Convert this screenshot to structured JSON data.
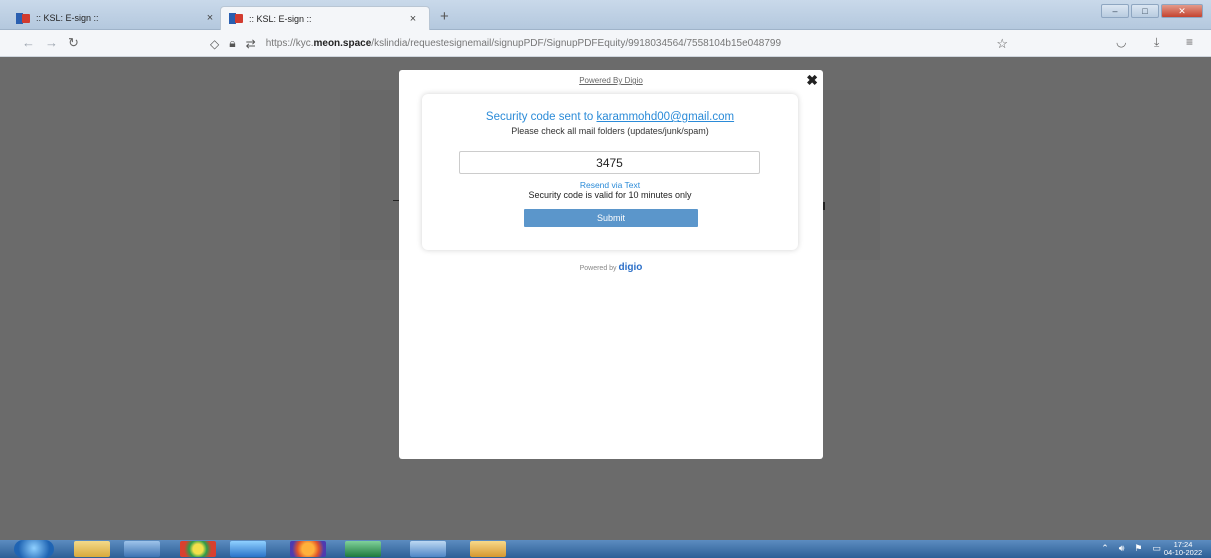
{
  "browser": {
    "tabs": [
      {
        "label": ":: KSL: E-sign ::",
        "close": "×"
      },
      {
        "label": ":: KSL: E-sign ::",
        "close": "×"
      }
    ],
    "new_tab": "+",
    "url_pre": "https://kyc.",
    "url_bold": "meon.space",
    "url_post": "/kslindia/requestesignemail/signupPDF/SignupPDFEquity/9918034564/7558104b15e048799"
  },
  "modal": {
    "powered_top": "Powered By Digio",
    "close": "✖",
    "title_prefix": "Security code sent to ",
    "email": "karammohd00@gmail.com",
    "subtitle": "Please check all mail folders (updates/junk/spam)",
    "code_value": "3475",
    "resend": "Resend via Text",
    "validity": "Security code is valid for 10 minutes only",
    "submit": "Submit",
    "powered_bottom_prefix": "Powered by ",
    "powered_bottom_brand": "digio"
  },
  "taskbar": {
    "time": "17:24",
    "date": "04-10-2022"
  },
  "colors": {
    "accent": "#2b8bd8",
    "submit": "#5b96cb",
    "overlay": "#6b6b6b"
  }
}
